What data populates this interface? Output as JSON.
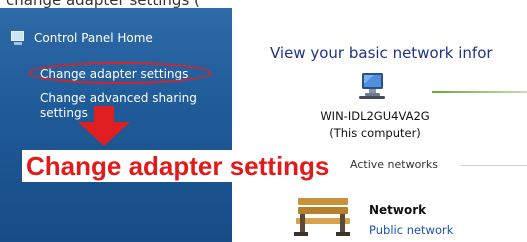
{
  "header_fragment": "change adapter settings (",
  "sidebar": {
    "home_label": "Control Panel Home",
    "links": [
      "Change adapter settings",
      "Change advanced sharing settings"
    ]
  },
  "annotation": {
    "caption": "Change adapter settings",
    "highlight_color": "#e02020"
  },
  "main": {
    "heading": "View your basic network infor",
    "computer_name": "WIN-IDL2GU4VA2G",
    "computer_sub": "(This computer)",
    "networks_label": "Active networks",
    "network": {
      "name": "Network",
      "type": "Public network"
    }
  },
  "icons": [
    "control-panel-home-icon",
    "computer-icon",
    "network-bench-icon",
    "down-arrow-icon"
  ]
}
